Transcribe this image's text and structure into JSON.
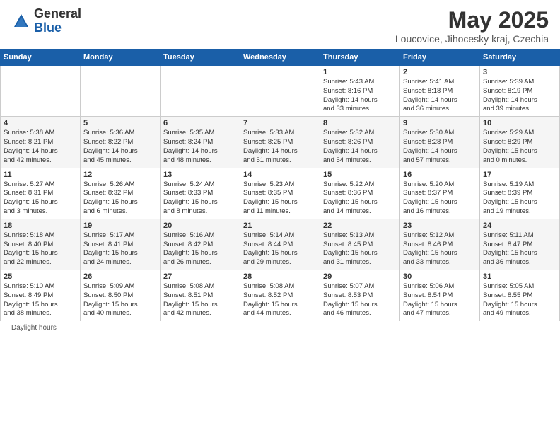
{
  "header": {
    "logo_general": "General",
    "logo_blue": "Blue",
    "title": "May 2025",
    "subtitle": "Loucovice, Jihocesky kraj, Czechia"
  },
  "days_of_week": [
    "Sunday",
    "Monday",
    "Tuesday",
    "Wednesday",
    "Thursday",
    "Friday",
    "Saturday"
  ],
  "weeks": [
    [
      {
        "day": "",
        "info": ""
      },
      {
        "day": "",
        "info": ""
      },
      {
        "day": "",
        "info": ""
      },
      {
        "day": "",
        "info": ""
      },
      {
        "day": "1",
        "info": "Sunrise: 5:43 AM\nSunset: 8:16 PM\nDaylight: 14 hours\nand 33 minutes."
      },
      {
        "day": "2",
        "info": "Sunrise: 5:41 AM\nSunset: 8:18 PM\nDaylight: 14 hours\nand 36 minutes."
      },
      {
        "day": "3",
        "info": "Sunrise: 5:39 AM\nSunset: 8:19 PM\nDaylight: 14 hours\nand 39 minutes."
      }
    ],
    [
      {
        "day": "4",
        "info": "Sunrise: 5:38 AM\nSunset: 8:21 PM\nDaylight: 14 hours\nand 42 minutes."
      },
      {
        "day": "5",
        "info": "Sunrise: 5:36 AM\nSunset: 8:22 PM\nDaylight: 14 hours\nand 45 minutes."
      },
      {
        "day": "6",
        "info": "Sunrise: 5:35 AM\nSunset: 8:24 PM\nDaylight: 14 hours\nand 48 minutes."
      },
      {
        "day": "7",
        "info": "Sunrise: 5:33 AM\nSunset: 8:25 PM\nDaylight: 14 hours\nand 51 minutes."
      },
      {
        "day": "8",
        "info": "Sunrise: 5:32 AM\nSunset: 8:26 PM\nDaylight: 14 hours\nand 54 minutes."
      },
      {
        "day": "9",
        "info": "Sunrise: 5:30 AM\nSunset: 8:28 PM\nDaylight: 14 hours\nand 57 minutes."
      },
      {
        "day": "10",
        "info": "Sunrise: 5:29 AM\nSunset: 8:29 PM\nDaylight: 15 hours\nand 0 minutes."
      }
    ],
    [
      {
        "day": "11",
        "info": "Sunrise: 5:27 AM\nSunset: 8:31 PM\nDaylight: 15 hours\nand 3 minutes."
      },
      {
        "day": "12",
        "info": "Sunrise: 5:26 AM\nSunset: 8:32 PM\nDaylight: 15 hours\nand 6 minutes."
      },
      {
        "day": "13",
        "info": "Sunrise: 5:24 AM\nSunset: 8:33 PM\nDaylight: 15 hours\nand 8 minutes."
      },
      {
        "day": "14",
        "info": "Sunrise: 5:23 AM\nSunset: 8:35 PM\nDaylight: 15 hours\nand 11 minutes."
      },
      {
        "day": "15",
        "info": "Sunrise: 5:22 AM\nSunset: 8:36 PM\nDaylight: 15 hours\nand 14 minutes."
      },
      {
        "day": "16",
        "info": "Sunrise: 5:20 AM\nSunset: 8:37 PM\nDaylight: 15 hours\nand 16 minutes."
      },
      {
        "day": "17",
        "info": "Sunrise: 5:19 AM\nSunset: 8:39 PM\nDaylight: 15 hours\nand 19 minutes."
      }
    ],
    [
      {
        "day": "18",
        "info": "Sunrise: 5:18 AM\nSunset: 8:40 PM\nDaylight: 15 hours\nand 22 minutes."
      },
      {
        "day": "19",
        "info": "Sunrise: 5:17 AM\nSunset: 8:41 PM\nDaylight: 15 hours\nand 24 minutes."
      },
      {
        "day": "20",
        "info": "Sunrise: 5:16 AM\nSunset: 8:42 PM\nDaylight: 15 hours\nand 26 minutes."
      },
      {
        "day": "21",
        "info": "Sunrise: 5:14 AM\nSunset: 8:44 PM\nDaylight: 15 hours\nand 29 minutes."
      },
      {
        "day": "22",
        "info": "Sunrise: 5:13 AM\nSunset: 8:45 PM\nDaylight: 15 hours\nand 31 minutes."
      },
      {
        "day": "23",
        "info": "Sunrise: 5:12 AM\nSunset: 8:46 PM\nDaylight: 15 hours\nand 33 minutes."
      },
      {
        "day": "24",
        "info": "Sunrise: 5:11 AM\nSunset: 8:47 PM\nDaylight: 15 hours\nand 36 minutes."
      }
    ],
    [
      {
        "day": "25",
        "info": "Sunrise: 5:10 AM\nSunset: 8:49 PM\nDaylight: 15 hours\nand 38 minutes."
      },
      {
        "day": "26",
        "info": "Sunrise: 5:09 AM\nSunset: 8:50 PM\nDaylight: 15 hours\nand 40 minutes."
      },
      {
        "day": "27",
        "info": "Sunrise: 5:08 AM\nSunset: 8:51 PM\nDaylight: 15 hours\nand 42 minutes."
      },
      {
        "day": "28",
        "info": "Sunrise: 5:08 AM\nSunset: 8:52 PM\nDaylight: 15 hours\nand 44 minutes."
      },
      {
        "day": "29",
        "info": "Sunrise: 5:07 AM\nSunset: 8:53 PM\nDaylight: 15 hours\nand 46 minutes."
      },
      {
        "day": "30",
        "info": "Sunrise: 5:06 AM\nSunset: 8:54 PM\nDaylight: 15 hours\nand 47 minutes."
      },
      {
        "day": "31",
        "info": "Sunrise: 5:05 AM\nSunset: 8:55 PM\nDaylight: 15 hours\nand 49 minutes."
      }
    ]
  ],
  "footer": {
    "daylight_label": "Daylight hours"
  }
}
